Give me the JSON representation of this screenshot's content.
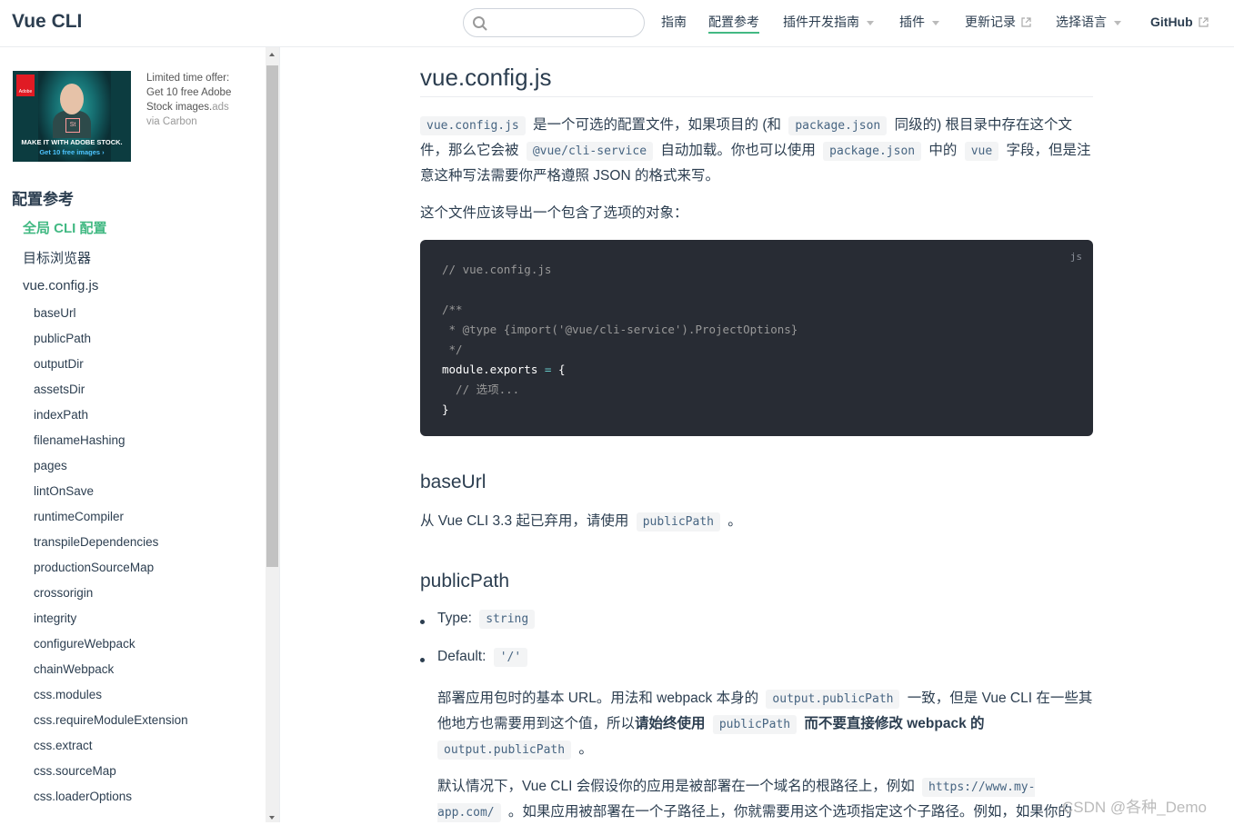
{
  "header": {
    "site_name": "Vue CLI",
    "search_placeholder": "",
    "nav": [
      {
        "label": "指南"
      },
      {
        "label": "配置参考"
      },
      {
        "label": "插件开发指南"
      },
      {
        "label": "插件"
      },
      {
        "label": "更新记录"
      },
      {
        "label": "选择语言"
      },
      {
        "label": "GitHub"
      }
    ]
  },
  "ad": {
    "image_tagline": "MAKE IT WITH ADOBE STOCK.",
    "image_cta": "Get 10 free images ›",
    "image_brand": "Adobe",
    "image_badge": "St",
    "line1": "Limited time offer: Get 10 free Adobe Stock images.",
    "ads_label": "ads",
    "via": "via Carbon"
  },
  "sidebar": {
    "heading": "配置参考",
    "level1": [
      {
        "label": "全局 CLI 配置"
      },
      {
        "label": "目标浏览器"
      },
      {
        "label": "vue.config.js"
      }
    ],
    "level2": [
      {
        "label": "baseUrl"
      },
      {
        "label": "publicPath"
      },
      {
        "label": "outputDir"
      },
      {
        "label": "assetsDir"
      },
      {
        "label": "indexPath"
      },
      {
        "label": "filenameHashing"
      },
      {
        "label": "pages"
      },
      {
        "label": "lintOnSave"
      },
      {
        "label": "runtimeCompiler"
      },
      {
        "label": "transpileDependencies"
      },
      {
        "label": "productionSourceMap"
      },
      {
        "label": "crossorigin"
      },
      {
        "label": "integrity"
      },
      {
        "label": "configureWebpack"
      },
      {
        "label": "chainWebpack"
      },
      {
        "label": "css.modules"
      },
      {
        "label": "css.requireModuleExtension"
      },
      {
        "label": "css.extract"
      },
      {
        "label": "css.sourceMap"
      },
      {
        "label": "css.loaderOptions"
      }
    ]
  },
  "content": {
    "title": "vue.config.js",
    "intro": {
      "code1": "vue.config.js",
      "t1": " 是一个可选的配置文件，如果项目的 (和 ",
      "code2": "package.json",
      "t2": " 同级的) 根目录中存在这个文件，那么它会被 ",
      "code3": "@vue/cli-service",
      "t3": " 自动加载。你也可以使用 ",
      "code4": "package.json",
      "t4": " 中的 ",
      "code5": "vue",
      "t5": " 字段，但是注意这种写法需要你严格遵照 JSON 的格式来写。"
    },
    "export_note": "这个文件应该导出一个包含了选项的对象：",
    "code_block": {
      "lang": "js",
      "line1": "// vue.config.js",
      "line3": "/**",
      "line4": " * @type {import('@vue/cli-service').ProjectOptions}",
      "line5": " */",
      "line6a": "module.exports",
      "line6b": " = ",
      "line6c": "{",
      "line7": "  // 选项...",
      "line8": "}"
    },
    "baseurl": {
      "heading": "baseUrl",
      "t1": "从 Vue CLI 3.3 起已弃用，请使用 ",
      "code": "publicPath",
      "t2": " 。"
    },
    "publicpath": {
      "heading": "publicPath",
      "type_label": "Type: ",
      "type_value": "string",
      "default_label": "Default: ",
      "default_value": "'/'",
      "p1_t1": "部署应用包时的基本 URL。用法和 webpack 本身的 ",
      "p1_code1": "output.publicPath",
      "p1_t2": " 一致，但是 Vue CLI 在一些其他地方也需要用到这个值，所以",
      "p1_b1": "请始终使用 ",
      "p1_code2": "publicPath",
      "p1_b2": " 而不要直接修改 webpack 的 ",
      "p1_code3": "output.publicPath",
      "p1_t3": " 。",
      "p2_t1": "默认情况下，Vue CLI 会假设你的应用是被部署在一个域名的根路径上，例如 ",
      "p2_code1": "https://www.my-app.com/",
      "p2_t2": " 。如果应用被部署在一个子路径上，你就需要用这个选项指定这个子路径。例如，如果你的"
    }
  },
  "watermark": "CSDN @各种_Demo"
}
